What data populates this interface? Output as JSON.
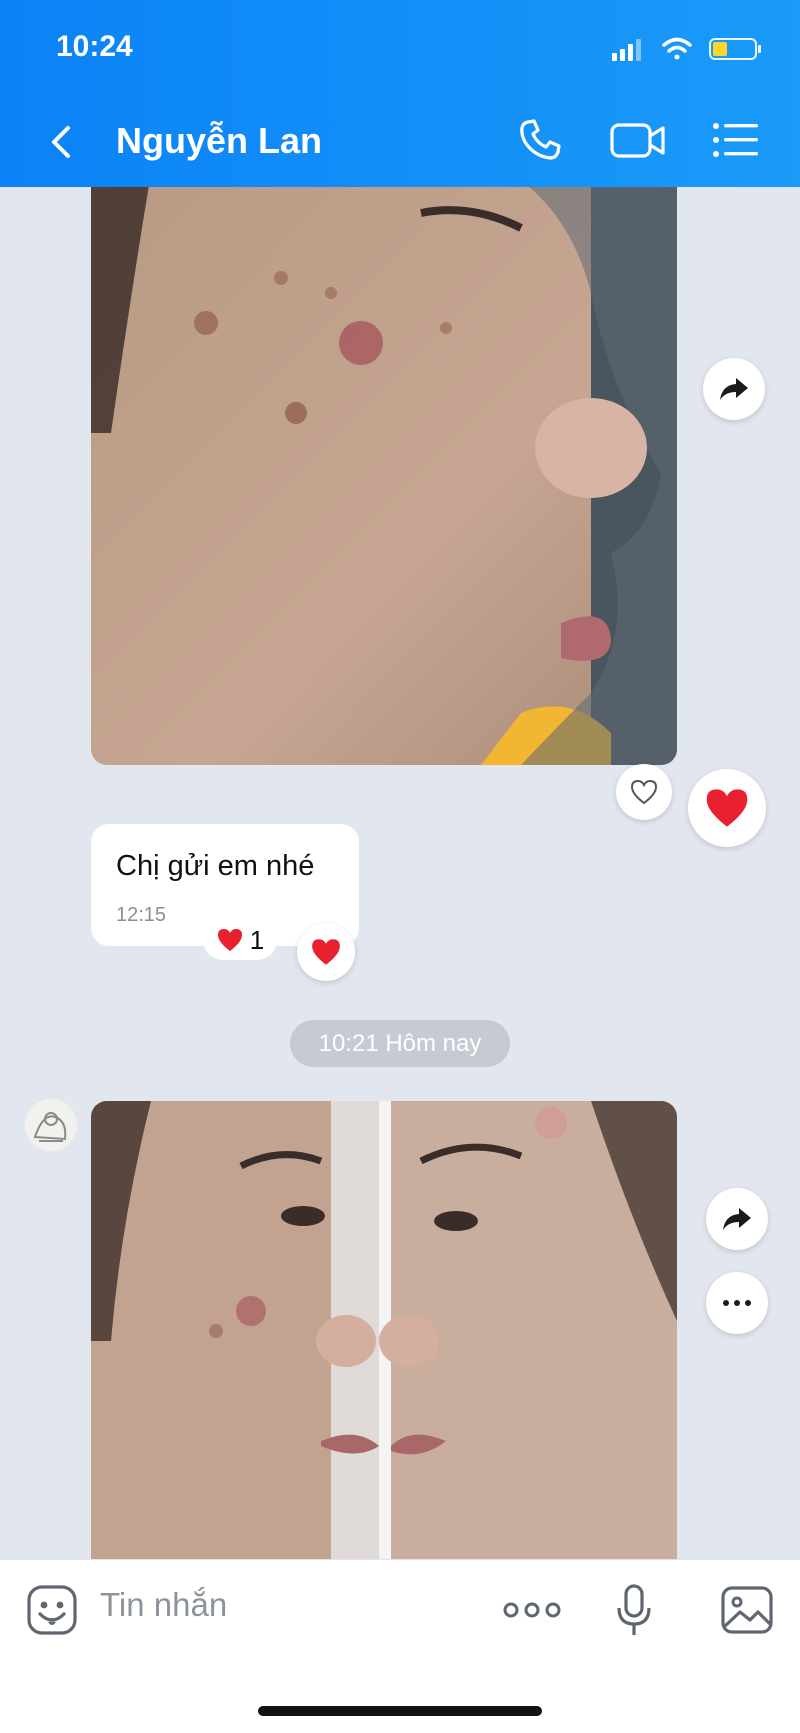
{
  "status": {
    "time": "10:24"
  },
  "header": {
    "title": "Nguyễn Lan"
  },
  "icons": {
    "back": "chevron-left-icon",
    "call": "phone-icon",
    "video": "video-camera-icon",
    "menu": "list-menu-icon",
    "forward": "forward-arrow-icon",
    "more": "more-horizontal-icon",
    "like": "heart-outline-icon",
    "heart": "heart-icon",
    "sticker": "sticker-icon",
    "dots": "more-options-icon",
    "mic": "microphone-icon",
    "image": "image-icon"
  },
  "messages": [
    {
      "type": "photo",
      "description": ""
    },
    {
      "type": "text",
      "text": "Chị gửi em nhé",
      "time": "12:15",
      "reaction_count": "1"
    },
    {
      "type": "photo",
      "description": ""
    }
  ],
  "divider": {
    "label": "10:21 Hôm nay"
  },
  "input": {
    "placeholder": "Tin nhắn"
  },
  "colors": {
    "header": "#0b82f7",
    "background": "#e2e6ee",
    "heart": "#e8202f"
  }
}
